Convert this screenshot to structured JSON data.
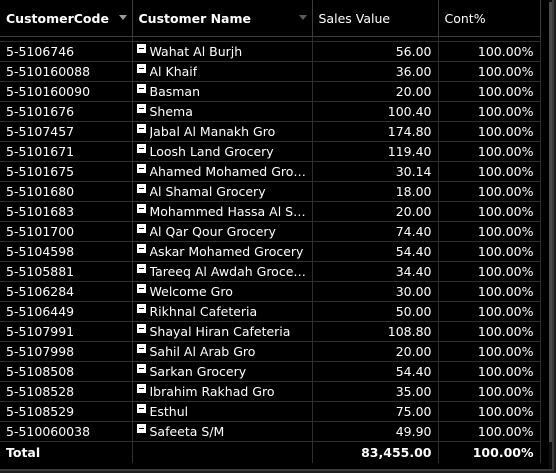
{
  "table": {
    "columns": [
      {
        "label": "CustomerCode"
      },
      {
        "label": "Customer Name"
      },
      {
        "label": "Sales Value"
      },
      {
        "label": "Cont%"
      }
    ],
    "rows": [
      {
        "code": "5-5106746",
        "name": "Wahat Al Burjh",
        "sales": "56.00",
        "cont": "100.00%"
      },
      {
        "code": "5-510160088",
        "name": "Al Khaif",
        "sales": "36.00",
        "cont": "100.00%"
      },
      {
        "code": "5-510160090",
        "name": "Basman",
        "sales": "20.00",
        "cont": "100.00%"
      },
      {
        "code": "5-5101676",
        "name": "Shema",
        "sales": "100.40",
        "cont": "100.00%"
      },
      {
        "code": "5-5107457",
        "name": "Jabal Al Manakh Gro",
        "sales": "174.80",
        "cont": "100.00%"
      },
      {
        "code": "5-5101671",
        "name": "Loosh Land Grocery",
        "sales": "119.40",
        "cont": "100.00%"
      },
      {
        "code": "5-5101675",
        "name": "Ahamed Mohamed Grocery",
        "sales": "30.14",
        "cont": "100.00%"
      },
      {
        "code": "5-5101680",
        "name": "Al Shamal Grocery",
        "sales": "18.00",
        "cont": "100.00%"
      },
      {
        "code": "5-5101683",
        "name": "Mohammed Hassa Al Shar...",
        "sales": "20.00",
        "cont": "100.00%"
      },
      {
        "code": "5-5101700",
        "name": "Al Qar Qour Grocery",
        "sales": "74.40",
        "cont": "100.00%"
      },
      {
        "code": "5-5104598",
        "name": "Askar Mohamed Grocery",
        "sales": "54.40",
        "cont": "100.00%"
      },
      {
        "code": "5-5105881",
        "name": "Tareeq Al Awdah Grocerry",
        "sales": "34.40",
        "cont": "100.00%"
      },
      {
        "code": "5-5106284",
        "name": "Welcome Gro",
        "sales": "30.00",
        "cont": "100.00%"
      },
      {
        "code": "5-5106449",
        "name": "Rikhnal Cafeteria",
        "sales": "50.00",
        "cont": "100.00%"
      },
      {
        "code": "5-5107991",
        "name": "Shayal Hiran Cafeteria",
        "sales": "108.80",
        "cont": "100.00%"
      },
      {
        "code": "5-5107998",
        "name": "Sahil Al Arab Gro",
        "sales": "20.00",
        "cont": "100.00%"
      },
      {
        "code": "5-5108508",
        "name": "Sarkan Grocery",
        "sales": "54.40",
        "cont": "100.00%"
      },
      {
        "code": "5-5108528",
        "name": "Ibrahim Rakhad Gro",
        "sales": "35.00",
        "cont": "100.00%"
      },
      {
        "code": "5-5108529",
        "name": "Esthul",
        "sales": "75.00",
        "cont": "100.00%"
      },
      {
        "code": "5-510060038",
        "name": "Safeeta S/M",
        "sales": "49.90",
        "cont": "100.00%"
      }
    ],
    "total": {
      "label": "Total",
      "sales": "83,455.00",
      "cont": "100.00%"
    }
  },
  "icons": {
    "sort": "dropdown-caret-icon",
    "row": "collapse-minus-icon"
  },
  "colors": {
    "background": "#000000",
    "text": "#ffffff",
    "grid": "#2e2e2e"
  }
}
